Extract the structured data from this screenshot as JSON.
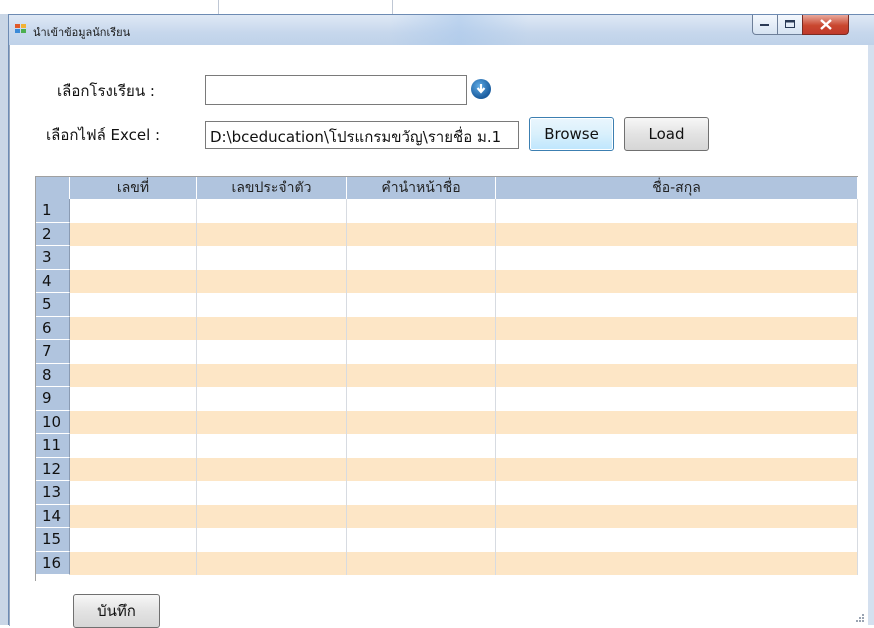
{
  "window": {
    "title": "นำเข้าข้อมูลนักเรียน",
    "controls": [
      "minimize",
      "maximize",
      "close"
    ]
  },
  "form": {
    "school_label": "เลือกโรงเรียน :",
    "school_value": "",
    "excel_label": "เลือกไฟล์ Excel :",
    "excel_value": "D:\\bceducation\\โปรแกรมขวัญ\\รายชื่อ ม.1",
    "browse_label": "Browse",
    "load_label": "Load",
    "save_label": "บันทึก"
  },
  "grid": {
    "columns": [
      "เลขที่",
      "เลขประจำตัว",
      "คำนำหน้าชื่อ",
      "ชื่อ-สกุล"
    ],
    "row_numbers": [
      "1",
      "2",
      "3",
      "4",
      "5",
      "6",
      "7",
      "8",
      "9",
      "10",
      "11",
      "12",
      "13",
      "14",
      "15",
      "16"
    ],
    "alt_row_color": "#fde6c6",
    "header_color": "#b0c4de"
  },
  "icons": {
    "app": "app-icon",
    "dropdown": "circle-down-arrow-icon"
  }
}
